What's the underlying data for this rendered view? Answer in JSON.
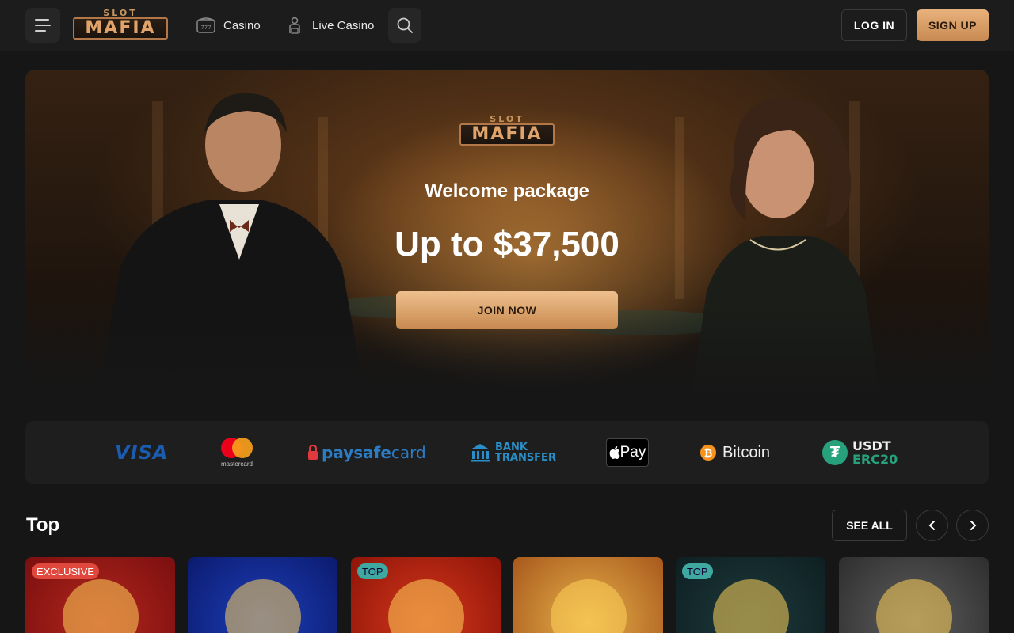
{
  "header": {
    "logo_top": "SLOT",
    "logo_main": "MAFIA",
    "nav": [
      {
        "label": "Casino",
        "icon": "slot-machine-icon"
      },
      {
        "label": "Live Casino",
        "icon": "dealer-icon"
      }
    ],
    "login_label": "LOG IN",
    "signup_label": "SIGN UP"
  },
  "hero": {
    "logo_top": "SLOT",
    "logo_main": "MAFIA",
    "title": "Welcome package",
    "amount": "Up to $37,500",
    "cta_label": "JOIN NOW"
  },
  "payments": {
    "visa": "VISA",
    "mastercard_label": "mastercard",
    "paysafe_pay": "paysafe",
    "paysafe_card": "card",
    "bank_line1": "BANK",
    "bank_line2": "TRANSFER",
    "applepay": "Pay",
    "bitcoin": "Bitcoin",
    "bitcoin_symbol": "₿",
    "usdt_line1": "USDT",
    "usdt_line2": "ERC20",
    "usdt_symbol": "₮"
  },
  "top_section": {
    "title": "Top",
    "see_all_label": "SEE ALL",
    "games": [
      {
        "badge": "EXCLUSIVE",
        "colors": [
          "#b3261e",
          "#7a0f0f"
        ]
      },
      {
        "badge": "",
        "colors": [
          "#1d3fb8",
          "#0b1a6e"
        ]
      },
      {
        "badge": "TOP",
        "colors": [
          "#d4381c",
          "#8e1408"
        ]
      },
      {
        "badge": "",
        "colors": [
          "#e6b14a",
          "#a8581c"
        ]
      },
      {
        "badge": "TOP",
        "colors": [
          "#1d3a3c",
          "#0e1f22"
        ]
      },
      {
        "badge": "",
        "colors": [
          "#5e5e5e",
          "#2e2e2e"
        ]
      }
    ]
  },
  "colors": {
    "accent": "#d9a06a",
    "background": "#161616",
    "header": "#1c1c1c"
  }
}
